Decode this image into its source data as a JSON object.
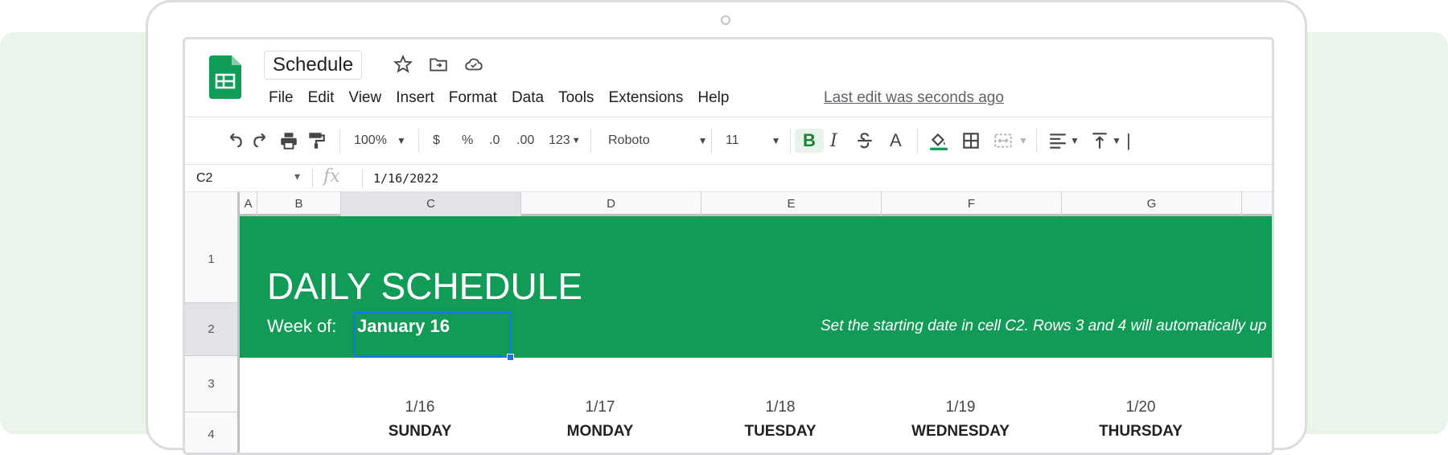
{
  "doc": {
    "title": "Schedule",
    "menu": [
      "File",
      "Edit",
      "View",
      "Insert",
      "Format",
      "Data",
      "Tools",
      "Extensions",
      "Help"
    ],
    "last_edit": "Last edit was seconds ago"
  },
  "toolbar": {
    "zoom": "100%",
    "currency": "$",
    "percent": "%",
    "decrease_decimal": ".0",
    "increase_decimal": ".00",
    "more_formats": "123",
    "font": "Roboto",
    "font_size": "11",
    "bold": "B",
    "italic": "I",
    "text_color": "A"
  },
  "formula_bar": {
    "cell_ref": "C2",
    "fx": "fx",
    "value": "1/16/2022"
  },
  "columns": [
    "A",
    "B",
    "C",
    "D",
    "E",
    "F",
    "G"
  ],
  "rows": [
    "1",
    "2",
    "3",
    "4"
  ],
  "sheet": {
    "heading": "DAILY SCHEDULE",
    "week_label": "Week of:",
    "week_value": "January 16",
    "hint": "Set the starting date in cell C2. Rows 3 and 4 will automatically up",
    "dates": [
      "1/16",
      "1/17",
      "1/18",
      "1/19",
      "1/20"
    ],
    "days": [
      "SUNDAY",
      "MONDAY",
      "TUESDAY",
      "WEDNESDAY",
      "THURSDAY"
    ]
  },
  "colors": {
    "header_green": "#129b56",
    "selection_blue": "#1a73e8",
    "sheets_logo_green": "#0f9d58"
  }
}
